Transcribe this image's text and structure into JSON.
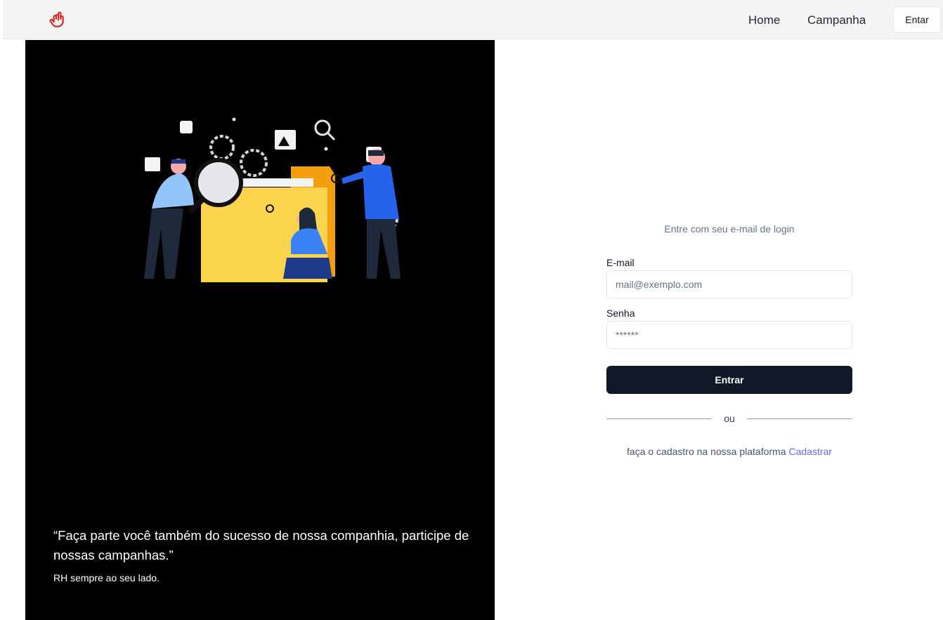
{
  "navbar": {
    "logo_icon": "rock-hand-icon",
    "logo_color": "#dc2626",
    "links": {
      "home": "Home",
      "campanha": "Campanha"
    },
    "login_button": "Entar"
  },
  "hero": {
    "quote": "“Faça parte você também do sucesso de nossa companhia, participe de nossas campanhas.”",
    "author": "RH sempre ao seu lado."
  },
  "login": {
    "subtitle": "Entre com seu e-mail de login",
    "email_label": "E-mail",
    "email_placeholder": "mail@exemplo.com",
    "password_label": "Senha",
    "password_placeholder": "******",
    "submit_label": "Entrar",
    "divider_text": "ou",
    "signup_text": "faça o cadastro na nossa plataforma",
    "signup_link": "Cadastrar"
  }
}
